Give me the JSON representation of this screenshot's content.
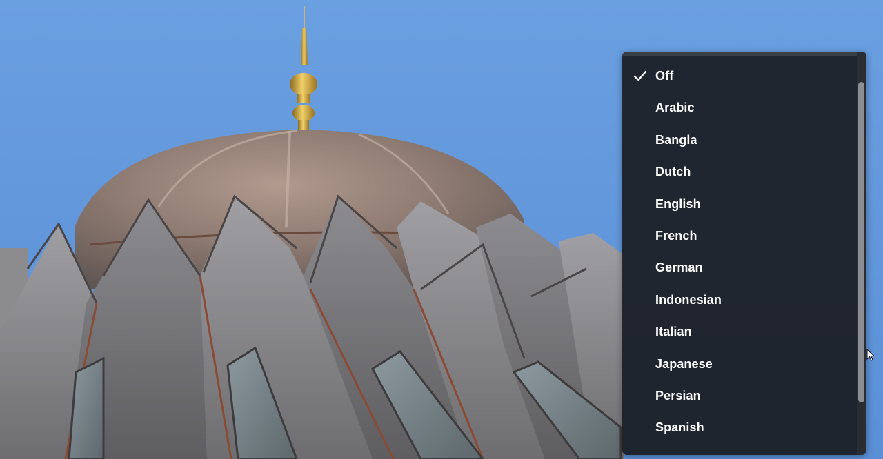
{
  "menu": {
    "selected_index": 0,
    "items": [
      {
        "label": "Off"
      },
      {
        "label": "Arabic"
      },
      {
        "label": "Bangla"
      },
      {
        "label": "Dutch"
      },
      {
        "label": "English"
      },
      {
        "label": "French"
      },
      {
        "label": "German"
      },
      {
        "label": "Indonesian"
      },
      {
        "label": "Italian"
      },
      {
        "label": "Japanese"
      },
      {
        "label": "Persian"
      },
      {
        "label": "Spanish"
      }
    ]
  },
  "icons": {
    "selected": "check-icon",
    "cursor": "mouse-pointer-icon"
  },
  "colors": {
    "sky": "#5f96db",
    "menu_background": "#1b1d21",
    "menu_text": "#ffffff",
    "dome": "#8a7870",
    "finial": "#d4a93a",
    "cladding": "#8c8b8d"
  }
}
